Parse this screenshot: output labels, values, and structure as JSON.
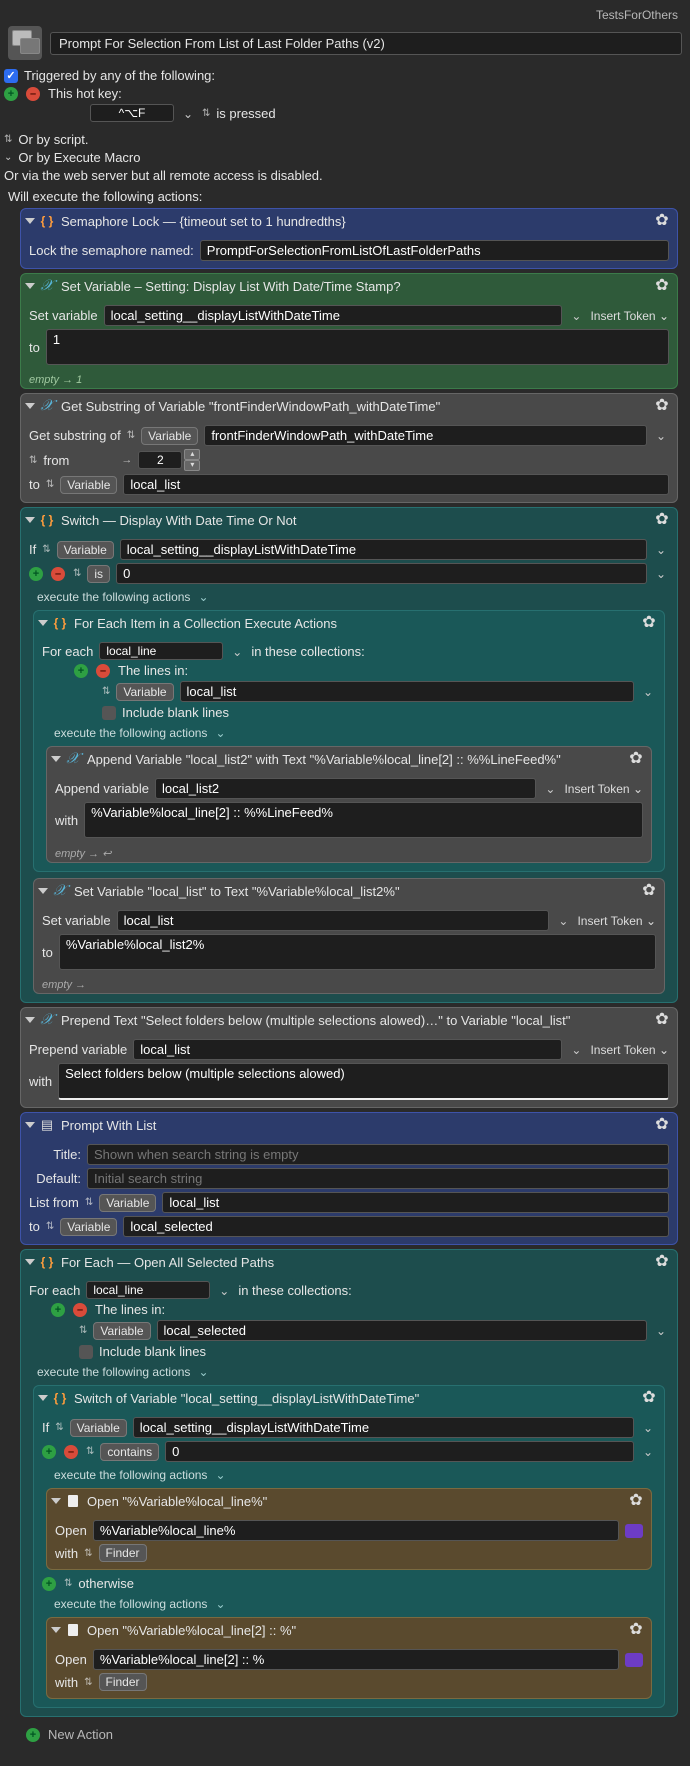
{
  "top_right": "TestsForOthers",
  "macro_title": "Prompt For Selection From List of Last Folder Paths (v2)",
  "triggers": {
    "heading": "Triggered by any of the following:",
    "hotkey_label": "This hot key:",
    "hotkey_value": "^⌥F",
    "hotkey_suffix": "is pressed",
    "by_script": "Or by script.",
    "by_execute": "Or by Execute Macro",
    "by_web": "Or via the web server but all remote access is disabled."
  },
  "will_execute": "Will execute the following actions:",
  "a1": {
    "title": "Semaphore Lock — {timeout set to 1 hundredths}",
    "label": "Lock the semaphore named:",
    "value": "PromptForSelectionFromListOfLastFolderPaths"
  },
  "a2": {
    "title": "Set Variable – Setting: Display List With Date/Time Stamp?",
    "label": "Set variable",
    "var": "local_setting__displayListWithDateTime",
    "to_label": "to",
    "to_value": "1",
    "token": "Insert Token",
    "empty": "empty → 1"
  },
  "a3": {
    "title": "Get Substring of Variable \"frontFinderWindowPath_withDateTime\"",
    "label": "Get substring of",
    "sel": "Variable",
    "val": "frontFinderWindowPath_withDateTime",
    "from_label": "from",
    "from_val": "2",
    "to_label": "to",
    "to_sel": "Variable",
    "to_val": "local_list"
  },
  "a4": {
    "title": "Switch — Display With Date Time Or Not",
    "if_label": "If",
    "if_sel": "Variable",
    "if_val": "local_setting__displayListWithDateTime",
    "cond": "is",
    "cond_val": "0",
    "exec": "execute the following actions"
  },
  "a4a": {
    "title": "For Each Item in a Collection Execute Actions",
    "foreach_label": "For each",
    "foreach_val": "local_line",
    "foreach_suffix": "in these collections:",
    "lines_in": "The lines in:",
    "var_sel": "Variable",
    "var_val": "local_list",
    "blank": "Include blank lines",
    "exec": "execute the following actions"
  },
  "a4a1": {
    "title": "Append Variable \"local_list2\" with Text \"%Variable%local_line[2] :: %%LineFeed%\"",
    "label": "Append variable",
    "var": "local_list2",
    "token": "Insert Token",
    "with_label": "with",
    "with_val": "%Variable%local_line[2] :: %%LineFeed%",
    "empty": "empty → ↩"
  },
  "a4a2": {
    "title": "Set Variable \"local_list\" to Text \"%Variable%local_list2%\"",
    "label": "Set variable",
    "var": "local_list",
    "token": "Insert Token",
    "to_label": "to",
    "to_val": "%Variable%local_list2%",
    "empty": "empty →"
  },
  "a5": {
    "title": "Prepend Text \"Select folders below (multiple selections alowed)…\" to Variable \"local_list\"",
    "label": "Prepend variable",
    "var": "local_list",
    "token": "Insert Token",
    "with_label": "with",
    "with_val": "Select folders below (multiple selections alowed)"
  },
  "a6": {
    "title": "Prompt With List",
    "title_lbl": "Title:",
    "title_ph": "Shown when search string is empty",
    "default_lbl": "Default:",
    "default_ph": "Initial search string",
    "list_lbl": "List from",
    "list_sel": "Variable",
    "list_val": "local_list",
    "to_lbl": "to",
    "to_sel": "Variable",
    "to_val": "local_selected"
  },
  "a7": {
    "title": "For Each — Open All Selected Paths",
    "foreach_label": "For each",
    "foreach_val": "local_line",
    "foreach_suffix": "in these collections:",
    "lines_in": "The lines in:",
    "var_sel": "Variable",
    "var_val": "local_selected",
    "blank": "Include blank lines",
    "exec": "execute the following actions"
  },
  "a7a": {
    "title": "Switch of Variable \"local_setting__displayListWithDateTime\"",
    "if_label": "If",
    "if_sel": "Variable",
    "if_val": "local_setting__displayListWithDateTime",
    "cond": "contains",
    "cond_val": "0",
    "exec": "execute the following actions",
    "otherwise": "otherwise",
    "exec2": "execute the following actions"
  },
  "a7a1": {
    "title": "Open \"%Variable%local_line%\"",
    "label": "Open",
    "val": "%Variable%local_line%",
    "with_label": "with",
    "with_val": "Finder"
  },
  "a7a2": {
    "title": "Open \"%Variable%local_line[2] :: %\"",
    "label": "Open",
    "val": "%Variable%local_line[2] :: %",
    "with_label": "with",
    "with_val": "Finder"
  },
  "new_action": "New Action"
}
